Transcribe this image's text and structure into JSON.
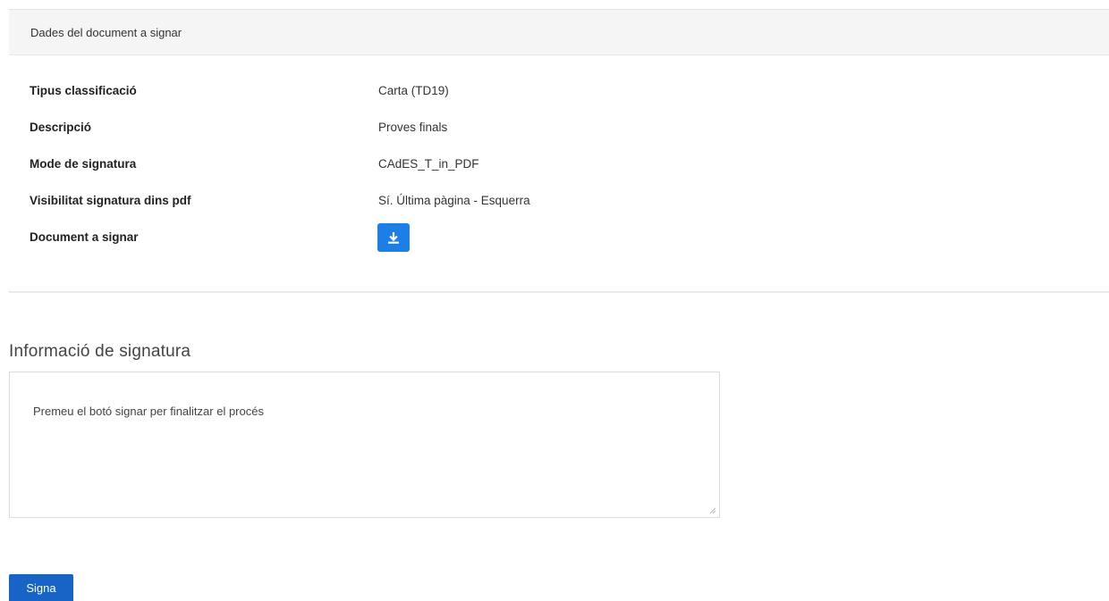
{
  "panel": {
    "heading": "Dades del document a signar",
    "fields": [
      {
        "label": "Tipus classificació",
        "value": "Carta (TD19)"
      },
      {
        "label": "Descripció",
        "value": "Proves finals"
      },
      {
        "label": "Mode de signatura",
        "value": "CAdES_T_in_PDF"
      },
      {
        "label": "Visibilitat signatura dins pdf",
        "value": "Sí. Última pàgina - Esquerra"
      }
    ],
    "document_label": "Document a signar",
    "download_icon": "download-icon"
  },
  "signature_info": {
    "title": "Informació de signatura",
    "message": "Premeu el botó signar per finalitzar el procés"
  },
  "actions": {
    "sign_label": "Signa"
  },
  "colors": {
    "download_button": "#1b7fe6",
    "sign_button": "#1764c6"
  }
}
